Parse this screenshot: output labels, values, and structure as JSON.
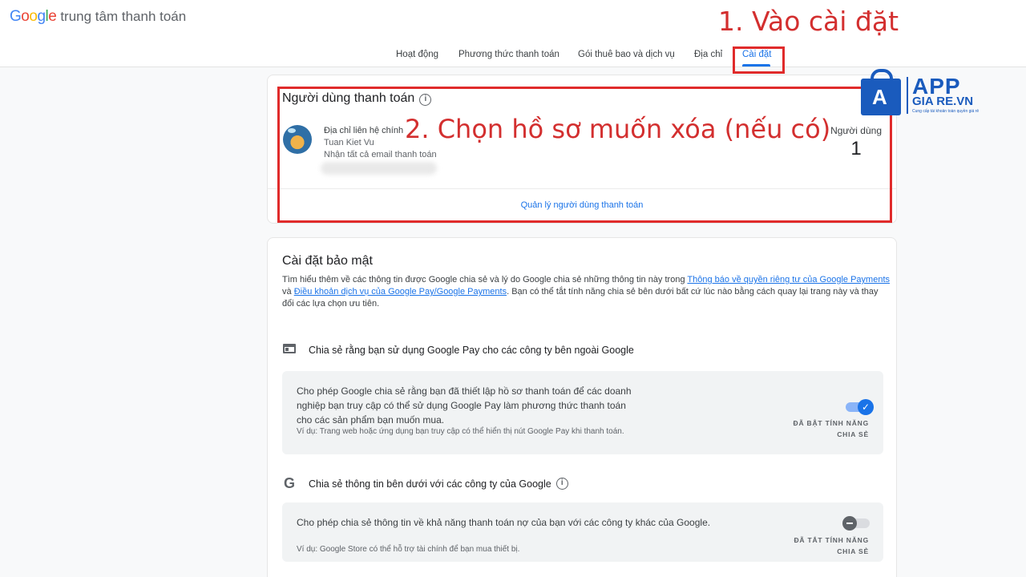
{
  "header": {
    "logo_text": "Google",
    "logo_colors": [
      "#4285F4",
      "#EA4335",
      "#FBBC05",
      "#4285F4",
      "#34A853",
      "#EA4335"
    ],
    "app_title": "trung tâm thanh toán"
  },
  "tabs": [
    {
      "label": "Hoạt động",
      "active": false
    },
    {
      "label": "Phương thức thanh toán",
      "active": false
    },
    {
      "label": "Gói thuê bao và dịch vụ",
      "active": false
    },
    {
      "label": "Địa chỉ",
      "active": false
    },
    {
      "label": "Cài đặt",
      "active": true
    }
  ],
  "annotations": {
    "step1": "1. Vào cài đặt",
    "step2": "2. Chọn hồ sơ muốn xóa (nếu có)",
    "color": "#d32f2f"
  },
  "payment_users": {
    "title": "Người dùng thanh toán",
    "contact_label": "Địa chỉ liên hệ chính",
    "contact_name": "Tuan Kiet Vu",
    "contact_note": "Nhận tất cả email thanh toán",
    "users_label": "Người dùng",
    "users_count": "1",
    "manage_link": "Quản lý người dùng thanh toán"
  },
  "security": {
    "title": "Cài đặt bảo mật",
    "desc_part1": "Tìm hiểu thêm về các thông tin được Google chia sẻ và lý do Google chia sẻ những thông tin này trong ",
    "link1": "Thông báo về quyền riêng tư của Google Payments",
    "desc_part2": " và ",
    "link2": "Điều khoản dịch vụ của Google Pay/Google Payments",
    "desc_part3": ". Bạn có thể tắt tính năng chia sẻ bên dưới bất cứ lúc nào bằng cách quay lại trang này và thay đổi các lựa chọn ưu tiên.",
    "section1": {
      "icon": "browser-icon",
      "heading": "Chia sẻ rằng bạn sử dụng Google Pay cho các công ty bên ngoài Google",
      "text": "Cho phép Google chia sẻ rằng bạn đã thiết lập hồ sơ thanh toán để các doanh nghiệp bạn truy cập có thể sử dụng Google Pay làm phương thức thanh toán cho các sản phẩm bạn muốn mua.",
      "example": "Ví dụ: Trang web hoặc ứng dụng bạn truy cập có thể hiển thị nút Google Pay khi thanh toán.",
      "toggle_on": true,
      "status_line1": "ĐÃ BẬT TÍNH NĂNG",
      "status_line2": "CHIA SẺ"
    },
    "section2": {
      "icon": "google-g-icon",
      "heading": "Chia sẻ thông tin bên dưới với các công ty của Google",
      "text": "Cho phép chia sẻ thông tin về khả năng thanh toán nợ của bạn với các công ty khác của Google.",
      "example": "Ví dụ: Google Store có thể hỗ trợ tài chính để bạn mua thiết bị.",
      "toggle_on": false,
      "status_line1": "ĐÃ TẮT TÍNH NĂNG",
      "status_line2": "CHIA SẺ"
    }
  },
  "watermark": {
    "app": "APP",
    "site": "GIA RE.VN",
    "tagline": "Cung cấp tài khoản toàn quyền giá rẻ",
    "color": "#1a5bbd"
  }
}
